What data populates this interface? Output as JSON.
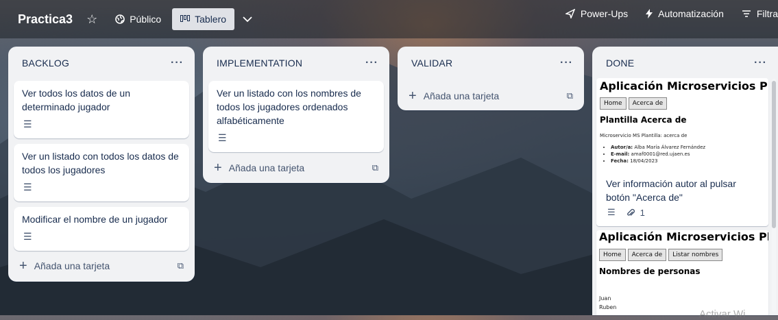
{
  "header": {
    "board_title": "Practica3",
    "visibility_label": "Público",
    "view_label": "Tablero",
    "power_ups_label": "Power-Ups",
    "automation_label": "Automatización",
    "filter_label": "Filtra"
  },
  "lists": [
    {
      "title": "BACKLOG",
      "cards": [
        {
          "text": "Ver todos los datos de un determinado jugador"
        },
        {
          "text": "Ver un listado con todos los datos de todos los jugadores"
        },
        {
          "text": "Modificar el nombre de un jugador"
        }
      ],
      "add_label": "Añada una tarjeta"
    },
    {
      "title": "IMPLEMENTATION",
      "cards": [
        {
          "text": "Ver un listado con los nombres de todos los jugadores ordenados alfabéticamente"
        }
      ],
      "add_label": "Añada una tarjeta"
    },
    {
      "title": "VALIDAR",
      "cards": [],
      "add_label": "Añada una tarjeta"
    },
    {
      "title": "DONE",
      "cards": [
        {
          "cover": {
            "title": "Aplicación Microservicios Plantilla",
            "buttons": [
              "Home",
              "Acerca de"
            ],
            "heading": "Plantilla Acerca de",
            "line": "Microservicio MS Plantilla: acerca de",
            "items": [
              {
                "label": "Autor/a:",
                "value": "Alba María Álvarez Fernández"
              },
              {
                "label": "E-mail:",
                "value": "amaf0001@red.ujaen.es"
              },
              {
                "label": "Fecha:",
                "value": "18/04/2023"
              }
            ]
          },
          "text": "Ver información autor al pulsar botón \"Acerca de\"",
          "attachments": "1"
        },
        {
          "cover": {
            "title": "Aplicación Microservicios Plantilla",
            "buttons": [
              "Home",
              "Acerca de",
              "Listar nombres"
            ],
            "heading": "Nombres de personas",
            "names": [
              "Juan",
              "Ruben"
            ]
          }
        }
      ]
    }
  ],
  "overlay_text": "Activar Wi"
}
